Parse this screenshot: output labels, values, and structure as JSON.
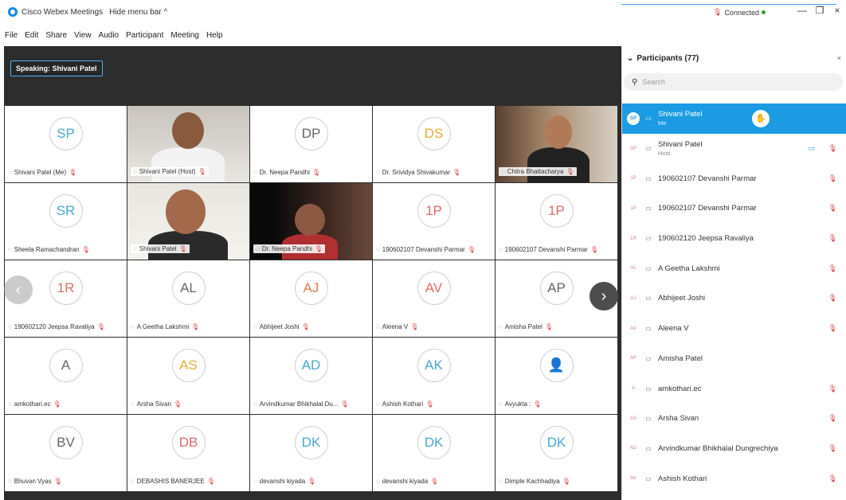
{
  "window": {
    "app_title": "Cisco Webex Meetings",
    "hide_menu_label": "Hide menu bar ^",
    "connection_status": "Connected",
    "controls": [
      "—",
      "❐",
      "×"
    ]
  },
  "menu": [
    "File",
    "Edit",
    "Share",
    "View",
    "Audio",
    "Participant",
    "Meeting",
    "Help"
  ],
  "speaking_label": "Speaking: Shivani Patel",
  "tiles": [
    {
      "initials": "SP",
      "name": "Shivani Patel (Me)",
      "initials_color": "#4aa8d0"
    },
    {
      "initials": "",
      "name": "Shivani Patel (Host)",
      "video": "man"
    },
    {
      "initials": "DP",
      "name": "Dr. Neepa Pandhi",
      "initials_color": "#666666"
    },
    {
      "initials": "DS",
      "name": "Dr. Srividya Shivakumar",
      "initials_color": "#e0b030"
    },
    {
      "initials": "",
      "name": "Chitra Bhattacharya",
      "video": "woman-room"
    },
    {
      "initials": "SR",
      "name": "Sheela Ramachandran",
      "initials_color": "#4aa8d0"
    },
    {
      "initials": "",
      "name": "Shivani Patel",
      "video": "woman-headset",
      "active": true
    },
    {
      "initials": "",
      "name": "Dr. Neepa Pandhi",
      "video": "woman-dark"
    },
    {
      "initials": "1P",
      "name": "190602107 Devanshi Parmar",
      "initials_color": "#e06a6a"
    },
    {
      "initials": "1P",
      "name": "190602107 Devanshi Parmar",
      "initials_color": "#e06a6a"
    },
    {
      "initials": "1R",
      "name": "190602120 Jeepsa Ravaliya",
      "initials_color": "#e06a6a"
    },
    {
      "initials": "AL",
      "name": "A Geetha Lakshmi",
      "initials_color": "#666666"
    },
    {
      "initials": "AJ",
      "name": "Abhijeet Joshi",
      "initials_color": "#e07a50"
    },
    {
      "initials": "AV",
      "name": "Aleena V",
      "initials_color": "#e06a6a"
    },
    {
      "initials": "AP",
      "name": "Amisha Patel",
      "initials_color": "#666666"
    },
    {
      "initials": "A",
      "name": "amkothari.ec",
      "initials_color": "#666666"
    },
    {
      "initials": "AS",
      "name": "Arsha Sivan",
      "initials_color": "#e0b030"
    },
    {
      "initials": "AD",
      "name": "Arvindkumar Bhikhalal Du...",
      "initials_color": "#4aa8d0"
    },
    {
      "initials": "AK",
      "name": "Ashish Kothari",
      "initials_color": "#4aa8d0"
    },
    {
      "initials": "",
      "name": "Avyukta :",
      "initials_color": "#999999",
      "user_icon": true
    },
    {
      "initials": "BV",
      "name": "Bhuvan Vyas",
      "initials_color": "#666666"
    },
    {
      "initials": "DB",
      "name": "DEBASHIS BANERJEE",
      "initials_color": "#e06a6a"
    },
    {
      "initials": "DK",
      "name": "devanshi kiyada",
      "initials_color": "#4aa8d0"
    },
    {
      "initials": "DK",
      "name": "devanshi kiyada",
      "initials_color": "#4aa8d0"
    },
    {
      "initials": "DK",
      "name": "Dimple Kachhadiya",
      "initials_color": "#4aa8d0"
    }
  ],
  "panel": {
    "title": "Participants (77)",
    "search_placeholder": "Search",
    "participants": [
      {
        "initials": "SP",
        "name": "Shivani Patel",
        "sub": "Me",
        "selected": true
      },
      {
        "initials": "SP",
        "name": "Shivani Patel",
        "sub": "Host",
        "video": true,
        "mic": true
      },
      {
        "initials": "1P",
        "name": "190602107 Devanshi Parmar",
        "mic": true
      },
      {
        "initials": "1P",
        "name": "190602107 Devanshi Parmar",
        "mic": true
      },
      {
        "initials": "1R",
        "name": "190602120 Jeepsa Ravaliya",
        "mic": true
      },
      {
        "initials": "AL",
        "name": "A Geetha Lakshmi",
        "mic": true
      },
      {
        "initials": "AJ",
        "name": "Abhijeet Joshi",
        "mic": true
      },
      {
        "initials": "AV",
        "name": "Aleena V",
        "mic": true
      },
      {
        "initials": "AP",
        "name": "Amisha Patel",
        "mic": false
      },
      {
        "initials": "A",
        "name": "amkothari.ec",
        "mic": true
      },
      {
        "initials": "AS",
        "name": "Arsha Sivan",
        "mic": true
      },
      {
        "initials": "AD",
        "name": "Arvindkumar Bhikhalal Dungrechiya",
        "mic": true
      },
      {
        "initials": "AK",
        "name": "Ashish Kothari",
        "mic": true
      }
    ]
  },
  "colors": {
    "accent": "#1a9be3",
    "muted_mic": "#d63c3c",
    "grid_bg": "#2d2d2d"
  }
}
